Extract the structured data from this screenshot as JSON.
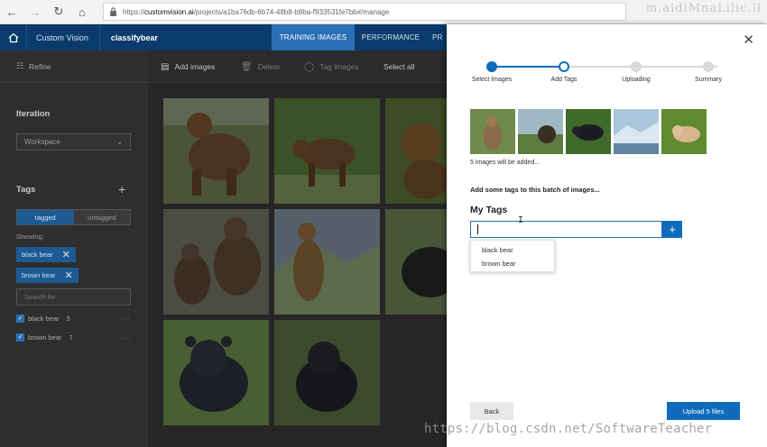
{
  "browser": {
    "url_prefix": "https://",
    "url_host": "customvision.ai",
    "url_path": "/projects/a1ba76db-6b74-48b8-b8ba-f933531fe7bb#/manage",
    "watermark_top": "m.aidiMnaLilic.ll"
  },
  "header": {
    "app_name": "Custom Vision",
    "project_name": "classifybear",
    "tabs": [
      {
        "label": "TRAINING IMAGES",
        "active": true
      },
      {
        "label": "PERFORMANCE",
        "active": false
      },
      {
        "label": "PR",
        "active": false
      }
    ]
  },
  "sidebar": {
    "refine_label": "Refine",
    "iteration_title": "Iteration",
    "workspace_value": "Workspace",
    "tags_title": "Tags",
    "toggle": {
      "tagged": "tagged",
      "untagged": "untagged"
    },
    "showing_label": "Showing:",
    "filter_chips": [
      "black bear",
      "brown bear"
    ],
    "search_placeholder": "Search for",
    "tags": [
      {
        "name": "black bear",
        "count": "5"
      },
      {
        "name": "brown bear",
        "count": "7"
      }
    ]
  },
  "toolbar": {
    "add_images": "Add images",
    "delete": "Delete",
    "tag_images": "Tag images",
    "select_all": "Select all"
  },
  "dialog": {
    "steps": [
      "Select Images",
      "Add Tags",
      "Uploading",
      "Summary"
    ],
    "current_step_index": 1,
    "count_text": "5 images will be added...",
    "batch_text": "Add some tags to this batch of images...",
    "my_tags_heading": "My Tags",
    "tag_input_value": "",
    "suggestions": [
      "black bear",
      "brown bear"
    ],
    "back_label": "Back",
    "upload_label": "Upload 5 files"
  },
  "watermark_bottom": "https://blog.csdn.net/SoftwareTeacher",
  "colors": {
    "accent": "#0f6cbd",
    "header_bg": "#0a3b6c",
    "active_tab": "#2a6fb5"
  }
}
